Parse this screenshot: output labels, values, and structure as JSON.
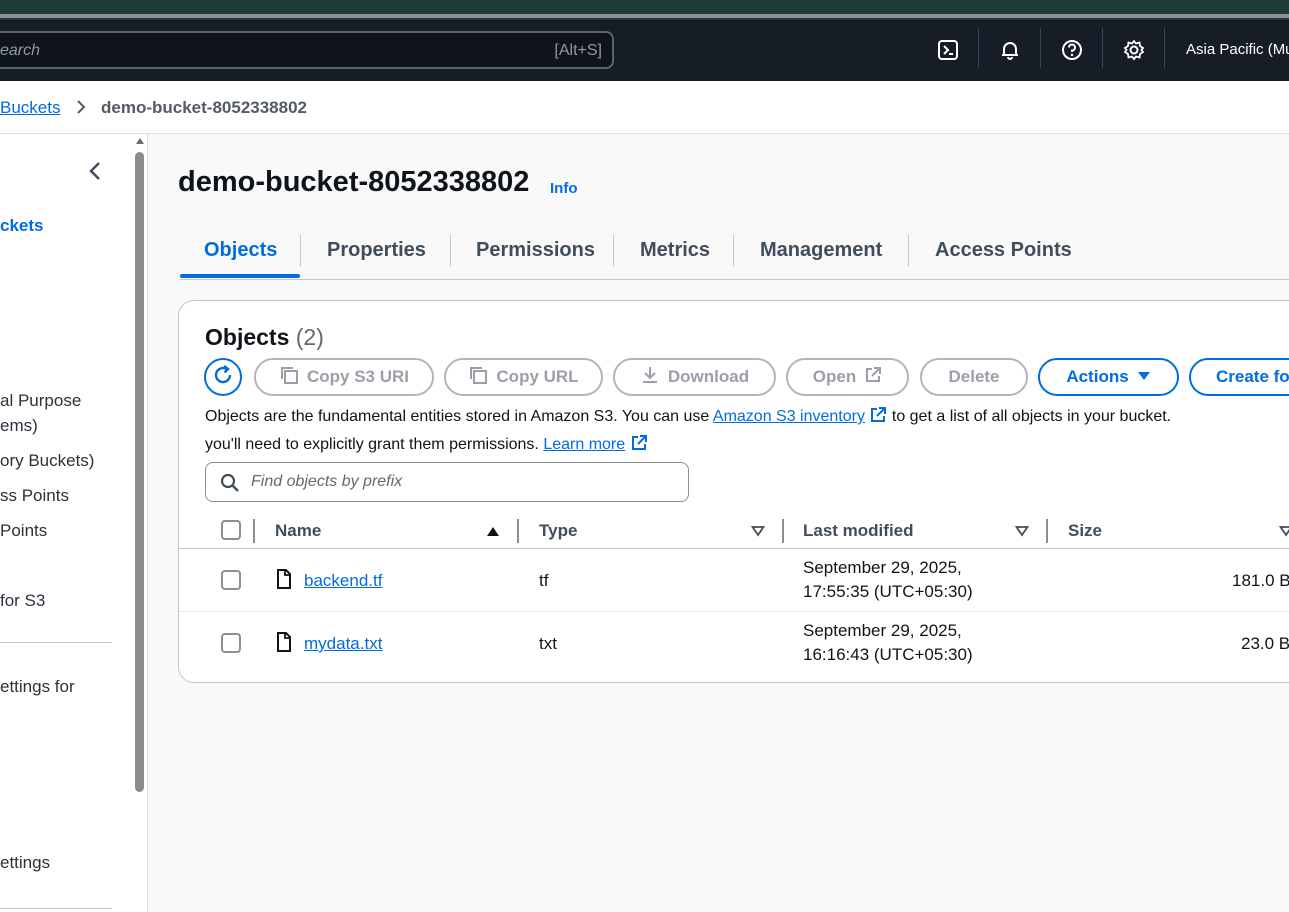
{
  "header": {
    "search_placeholder": "earch",
    "search_shortcut": "[Alt+S]",
    "region": "Asia Pacific (Mu"
  },
  "breadcrumb": {
    "parent": "Buckets",
    "current": "demo-bucket-8052338802"
  },
  "sidebar": {
    "items": [
      "ckets",
      "al Purpose",
      "ems)",
      "ory Buckets)",
      "ss Points",
      "Points",
      "for S3",
      "ettings for",
      "ettings"
    ]
  },
  "page": {
    "title": "demo-bucket-8052338802",
    "info": "Info"
  },
  "tabs": [
    "Objects",
    "Properties",
    "Permissions",
    "Metrics",
    "Management",
    "Access Points"
  ],
  "objects_panel": {
    "title": "Objects",
    "count": "(2)",
    "buttons": {
      "copy_s3_uri": "Copy S3 URI",
      "copy_url": "Copy URL",
      "download": "Download",
      "open": "Open",
      "delete": "Delete",
      "actions": "Actions",
      "create_folder": "Create fo"
    },
    "description": {
      "part1": "Objects are the fundamental entities stored in Amazon S3. You can use ",
      "link1": "Amazon S3 inventory",
      "part2": " to get a list of all objects in your bucket.",
      "part3": "you'll need to explicitly grant them permissions. ",
      "link2": "Learn more"
    },
    "find_placeholder": "Find objects by prefix",
    "columns": {
      "name": "Name",
      "type": "Type",
      "last_modified": "Last modified",
      "size": "Size"
    },
    "rows": [
      {
        "name": "backend.tf",
        "type": "tf",
        "modified_line1": "September 29, 2025,",
        "modified_line2": "17:55:35 (UTC+05:30)",
        "size": "181.0 B"
      },
      {
        "name": "mydata.txt",
        "type": "txt",
        "modified_line1": "September 29, 2025,",
        "modified_line2": "16:16:43 (UTC+05:30)",
        "size": "23.0 B"
      }
    ]
  },
  "colors": {
    "accent": "#006ce0",
    "header_bg": "#161d26",
    "disabled": "#9ba0a8"
  },
  "icons": [
    "cloudshell-icon",
    "bell-icon",
    "help-icon",
    "gear-icon",
    "refresh-icon",
    "copy-icon",
    "download-icon",
    "external-link-icon",
    "caret-down-icon",
    "search-icon",
    "file-icon",
    "sort-ascending-icon",
    "sort-icon",
    "chevron-left-icon",
    "chevron-right-icon"
  ]
}
